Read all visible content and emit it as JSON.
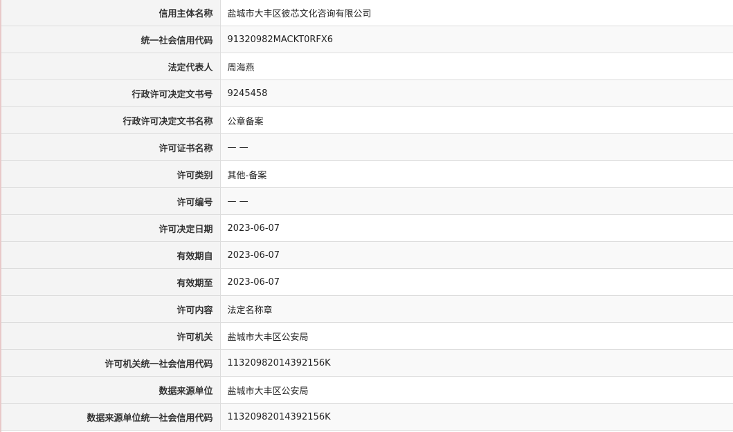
{
  "rows": [
    {
      "label": "信用主体名称",
      "value": "盐城市大丰区彼芯文化咨询有限公司"
    },
    {
      "label": "统一社会信用代码",
      "value": "91320982MACKT0RFX6"
    },
    {
      "label": "法定代表人",
      "value": "周海燕"
    },
    {
      "label": "行政许可决定文书号",
      "value": "9245458"
    },
    {
      "label": "行政许可决定文书名称",
      "value": "公章备案"
    },
    {
      "label": "许可证书名称",
      "value": "— —"
    },
    {
      "label": "许可类别",
      "value": "其他-备案"
    },
    {
      "label": "许可编号",
      "value": "— —"
    },
    {
      "label": "许可决定日期",
      "value": "2023-06-07"
    },
    {
      "label": "有效期自",
      "value": "2023-06-07"
    },
    {
      "label": "有效期至",
      "value": "2023-06-07"
    },
    {
      "label": "许可内容",
      "value": "法定名称章"
    },
    {
      "label": "许可机关",
      "value": "盐城市大丰区公安局"
    },
    {
      "label": "许可机关统一社会信用代码",
      "value": "11320982014392156K"
    },
    {
      "label": "数据来源单位",
      "value": "盐城市大丰区公安局"
    },
    {
      "label": "数据来源单位统一社会信用代码",
      "value": "11320982014392156K"
    }
  ]
}
